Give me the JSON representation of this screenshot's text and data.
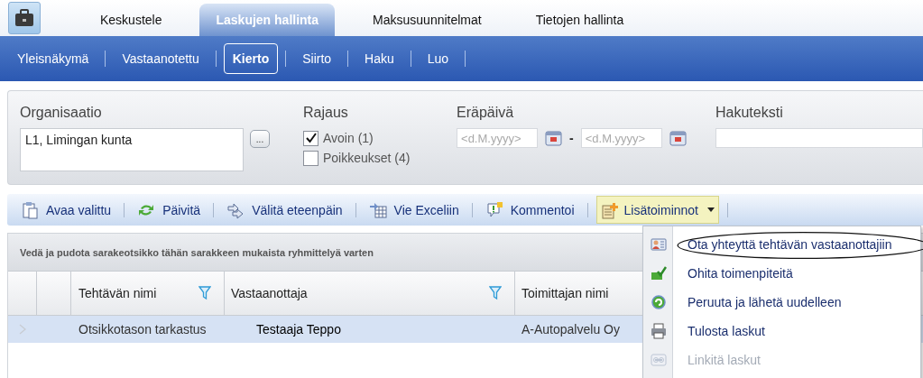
{
  "top_tabs": [
    {
      "label": "Keskustele",
      "selected": false
    },
    {
      "label": "Laskujen hallinta",
      "selected": true
    },
    {
      "label": "Maksusuunnitelmat",
      "selected": false
    },
    {
      "label": "Tietojen hallinta",
      "selected": false
    }
  ],
  "sub_nav": [
    {
      "label": "Yleisnäkymä",
      "selected": false
    },
    {
      "label": "Vastaanotettu",
      "selected": false
    },
    {
      "label": "Kierto",
      "selected": true
    },
    {
      "label": "Siirto",
      "selected": false
    },
    {
      "label": "Haku",
      "selected": false
    },
    {
      "label": "Luo",
      "selected": false
    }
  ],
  "filters": {
    "organization": {
      "label": "Organisaatio",
      "value": "L1, Limingan kunta",
      "browse_button": "..."
    },
    "scope": {
      "label": "Rajaus",
      "options": [
        {
          "label": "Avoin (1)",
          "checked": true
        },
        {
          "label": "Poikkeukset (4)",
          "checked": false
        }
      ]
    },
    "due_date": {
      "label": "Eräpäivä",
      "from_placeholder": "<d.M.yyyy>",
      "separator": "-",
      "to_placeholder": "<d.M.yyyy>"
    },
    "search_text": {
      "label": "Hakuteksti"
    }
  },
  "toolbar": [
    {
      "label": "Avaa valittu",
      "kind": "button"
    },
    {
      "label": "Päivitä",
      "kind": "button"
    },
    {
      "label": "Välitä eteenpäin",
      "kind": "button"
    },
    {
      "label": "Vie Exceliin",
      "kind": "button"
    },
    {
      "label": "Kommentoi",
      "kind": "button"
    },
    {
      "label": "Lisätoiminnot",
      "kind": "dropdown",
      "expanded": true
    }
  ],
  "grid": {
    "group_hint": "Vedä ja pudota sarakeotsikko tähän sarakkeen mukaista ryhmittelyä varten",
    "columns": [
      {
        "label": "Tehtävän nimi",
        "filter": true
      },
      {
        "label": "Vastaanottaja",
        "filter": true
      },
      {
        "label": "Toimittajan nimi",
        "filter": false
      }
    ],
    "rows": [
      {
        "selected": true,
        "cells": [
          "Otsikkotason tarkastus",
          "Testaaja Teppo",
          "A-Autopalvelu Oy"
        ]
      }
    ]
  },
  "menu": {
    "items": [
      {
        "label": "Ota yhteyttä tehtävän vastaanottajiin",
        "disabled": false,
        "circled": true
      },
      {
        "label": "Ohita toimenpiteitä",
        "disabled": false,
        "circled": false
      },
      {
        "label": "Peruuta ja lähetä uudelleen",
        "disabled": false,
        "circled": false
      },
      {
        "label": "Tulosta laskut",
        "disabled": false,
        "circled": false
      },
      {
        "label": "Linkitä laskut",
        "disabled": true,
        "circled": false
      }
    ]
  }
}
